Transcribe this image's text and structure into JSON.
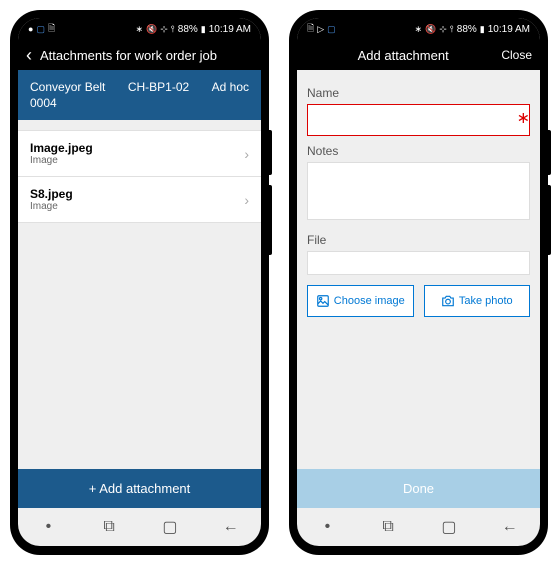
{
  "statusBar": {
    "signal": "88%",
    "time": "10:19 AM"
  },
  "screen1": {
    "title": "Attachments for work order job",
    "banner": {
      "line1": "Conveyor Belt",
      "line2": "0004",
      "mid": "CH-BP1-02",
      "right": "Ad hoc"
    },
    "items": [
      {
        "title": "Image.jpeg",
        "sub": "Image"
      },
      {
        "title": "S8.jpeg",
        "sub": "Image"
      }
    ],
    "addBtn": "Add attachment"
  },
  "screen2": {
    "title": "Add attachment",
    "close": "Close",
    "labels": {
      "name": "Name",
      "notes": "Notes",
      "file": "File"
    },
    "buttons": {
      "choose": "Choose image",
      "photo": "Take photo",
      "done": "Done"
    }
  }
}
